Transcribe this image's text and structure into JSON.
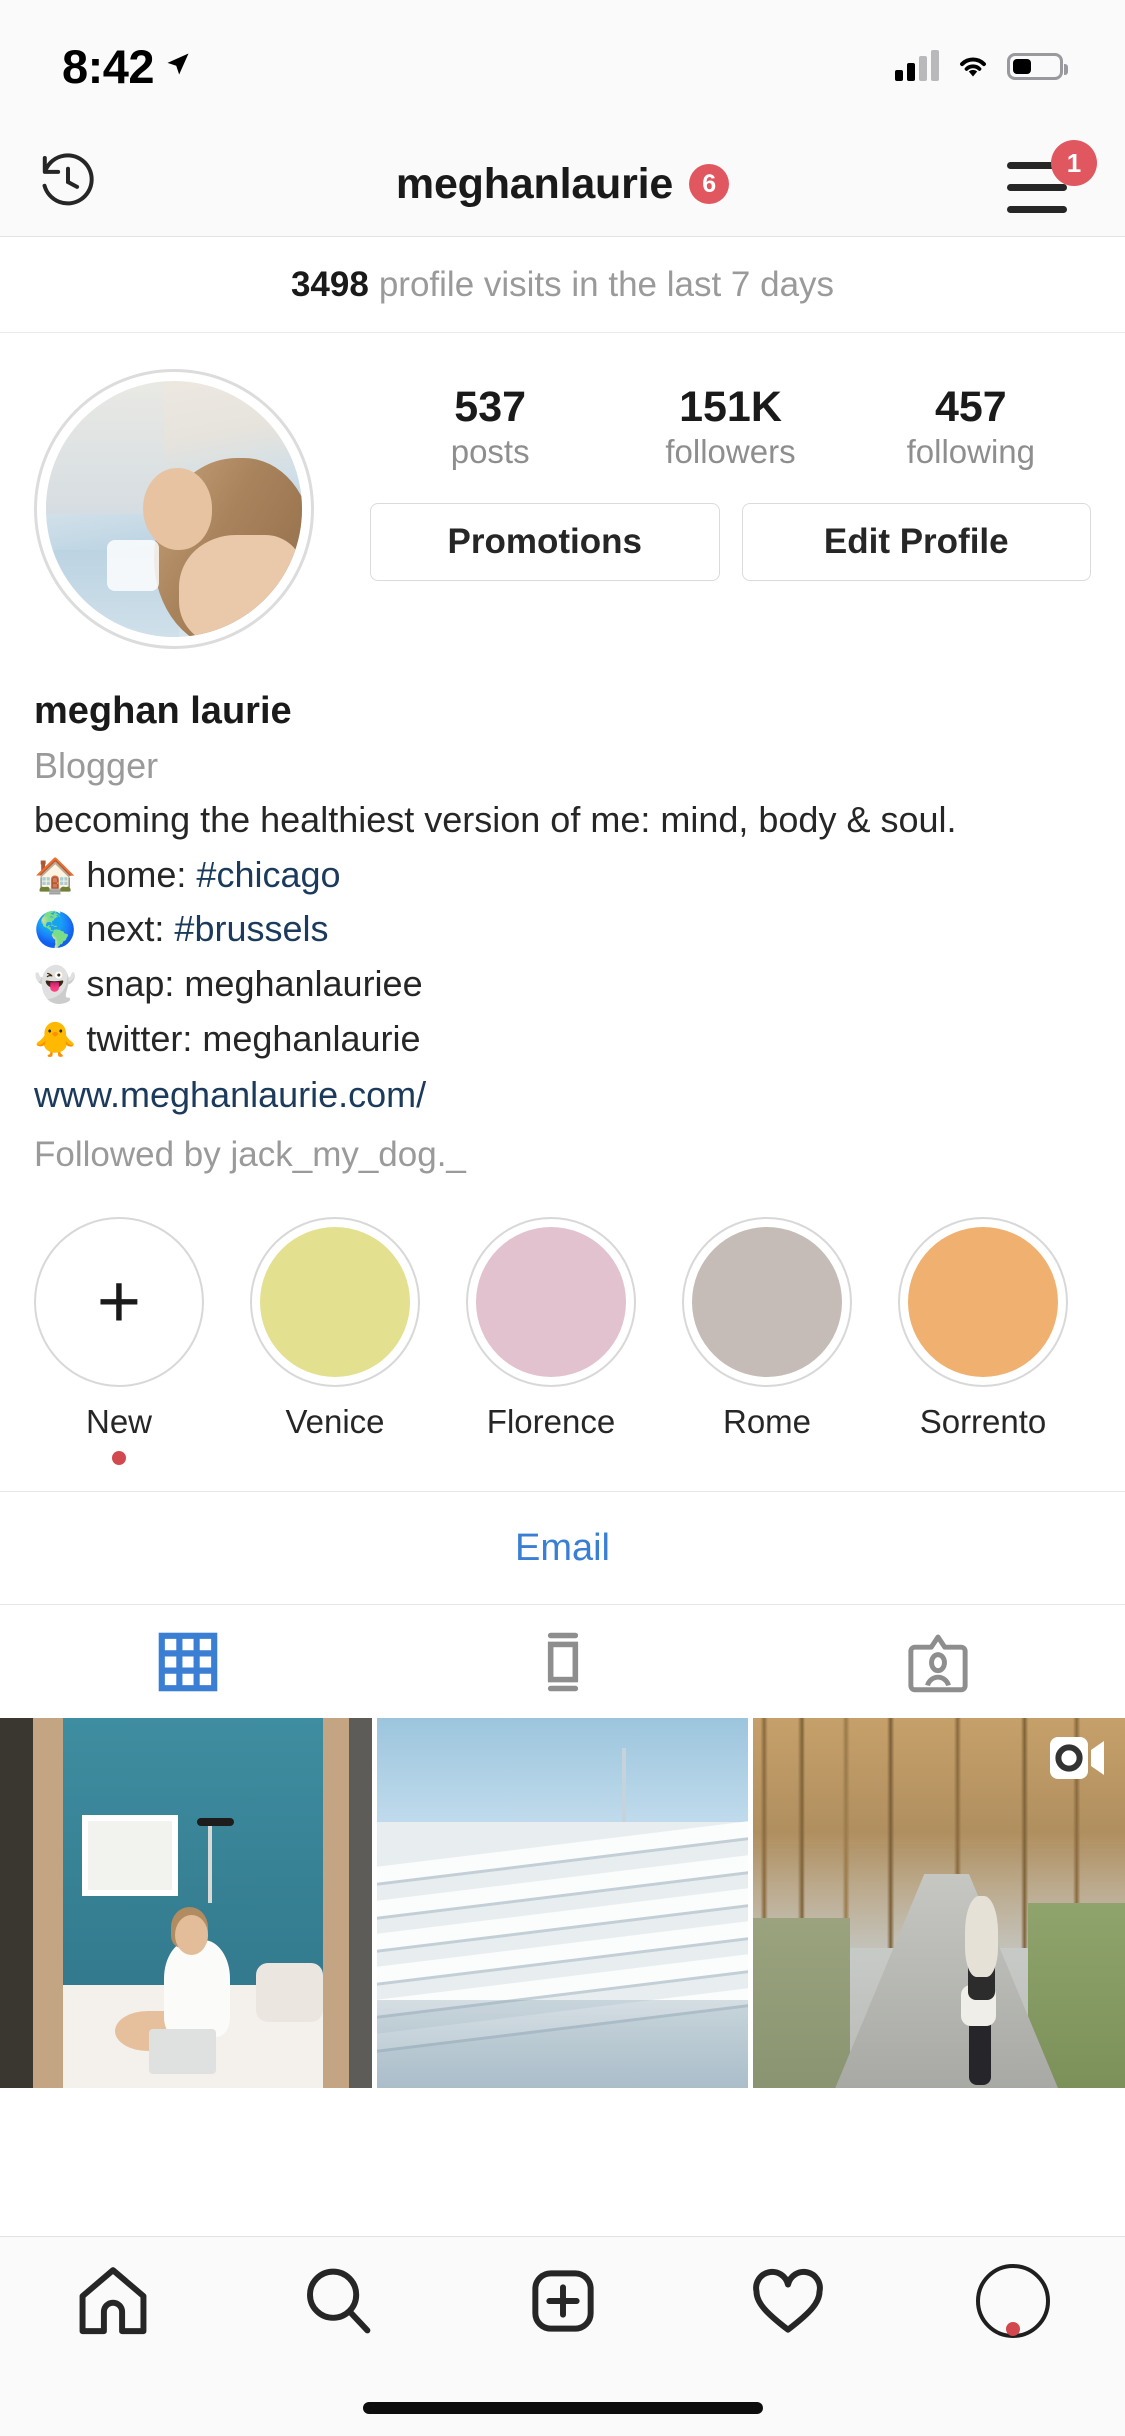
{
  "status_bar": {
    "time": "8:42",
    "location_icon": "location-arrow-icon",
    "signal_icon": "cellular-signal-icon",
    "wifi_icon": "wifi-icon",
    "battery_icon": "battery-icon",
    "battery_level_percent": 40
  },
  "nav": {
    "archive_icon": "archive-clock-icon",
    "username": "meghanlaurie",
    "username_badge": "6",
    "menu_icon": "hamburger-menu-icon",
    "menu_badge": "1",
    "badge_color": "#e0575f"
  },
  "insights": {
    "count": "3498",
    "label": "profile visits in the last 7 days"
  },
  "profile": {
    "avatar_name": "profile-avatar",
    "stats": [
      {
        "value": "537",
        "label": "posts"
      },
      {
        "value": "151K",
        "label": "followers"
      },
      {
        "value": "457",
        "label": "following"
      }
    ],
    "buttons": [
      {
        "name": "promotions-button",
        "label": "Promotions"
      },
      {
        "name": "edit-profile-button",
        "label": "Edit Profile"
      }
    ]
  },
  "bio": {
    "display_name": "meghan laurie",
    "category": "Blogger",
    "tagline": "becoming the healthiest version of me: mind, body & soul.",
    "lines": [
      {
        "emoji": "🏠",
        "emoji_name": "house-emoji",
        "text": "home: ",
        "tag": "#chicago"
      },
      {
        "emoji": "🌎",
        "emoji_name": "globe-emoji",
        "text": "next: ",
        "tag": "#brussels"
      },
      {
        "emoji": "👻",
        "emoji_name": "ghost-emoji",
        "text": "snap: meghanlauriee",
        "tag": ""
      },
      {
        "emoji": "🐥",
        "emoji_name": "chick-emoji",
        "text": "twitter: meghanlaurie",
        "tag": ""
      }
    ],
    "website": "www.meghanlaurie.com/",
    "followed_by": "Followed by jack_my_dog._",
    "link_color": "#1b3a5c"
  },
  "highlights": [
    {
      "label": "New",
      "color": "#ffffff",
      "is_new": true,
      "has_dot": true,
      "plus": "+"
    },
    {
      "label": "Venice",
      "color": "#e3e08f",
      "is_new": false,
      "has_dot": false
    },
    {
      "label": "Florence",
      "color": "#e2c2ce",
      "is_new": false,
      "has_dot": false
    },
    {
      "label": "Rome",
      "color": "#c5bcb7",
      "is_new": false,
      "has_dot": false
    },
    {
      "label": "Sorrento",
      "color": "#f0b070",
      "is_new": false,
      "has_dot": false
    }
  ],
  "email": {
    "label": "Email",
    "color": "#3b7fd4"
  },
  "content_tabs": [
    {
      "name": "tab-grid",
      "icon": "grid-icon",
      "active": true,
      "color": "#3b7fd4"
    },
    {
      "name": "tab-list",
      "icon": "list-feed-icon",
      "active": false,
      "color": "#8e8e8e"
    },
    {
      "name": "tab-tagged",
      "icon": "tagged-person-icon",
      "active": false,
      "color": "#8e8e8e"
    }
  ],
  "grid_posts": [
    {
      "name": "post-bedroom-laptop",
      "is_video": false
    },
    {
      "name": "post-bleachers",
      "is_video": false
    },
    {
      "name": "post-forest-road",
      "is_video": true,
      "video_icon": "video-camera-icon"
    }
  ],
  "bottom_nav": [
    {
      "name": "nav-home",
      "icon": "home-icon",
      "active": true
    },
    {
      "name": "nav-search",
      "icon": "search-icon",
      "active": false
    },
    {
      "name": "nav-add",
      "icon": "add-post-icon",
      "active": false
    },
    {
      "name": "nav-activity",
      "icon": "heart-icon",
      "active": false
    },
    {
      "name": "nav-profile",
      "icon": "profile-avatar-icon",
      "active": false,
      "has_dot": true
    }
  ]
}
